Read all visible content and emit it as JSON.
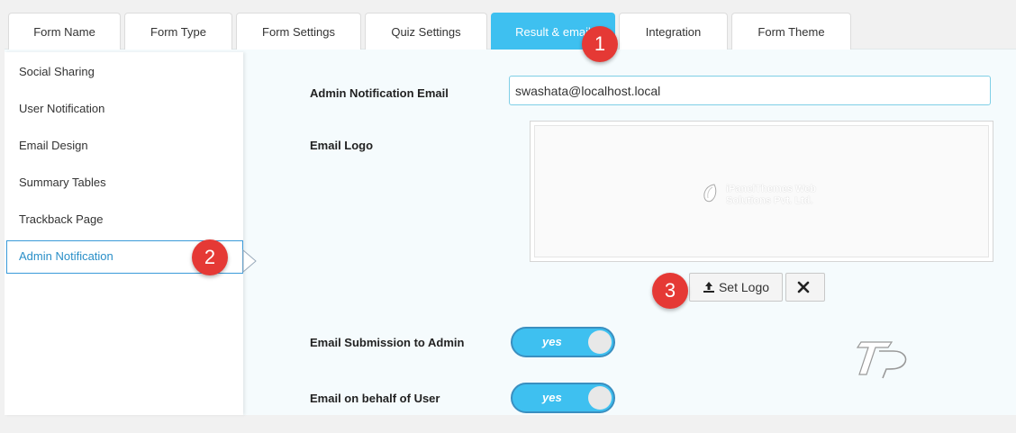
{
  "tabs": [
    {
      "label": "Form Name",
      "active": false
    },
    {
      "label": "Form Type",
      "active": false
    },
    {
      "label": "Form Settings",
      "active": false
    },
    {
      "label": "Quiz Settings",
      "active": false
    },
    {
      "label": "Result & email",
      "active": true
    },
    {
      "label": "Integration",
      "active": false
    },
    {
      "label": "Form Theme",
      "active": false
    }
  ],
  "sidebar": {
    "items": [
      {
        "label": "Social Sharing"
      },
      {
        "label": "User Notification"
      },
      {
        "label": "Email Design"
      },
      {
        "label": "Summary Tables"
      },
      {
        "label": "Trackback Page"
      },
      {
        "label": "Admin Notification",
        "active": true
      }
    ]
  },
  "form": {
    "admin_email_label": "Admin Notification Email",
    "admin_email_value": "swashata@localhost.local",
    "email_logo_label": "Email Logo",
    "logo_company_line1": "iPanelThemes Web",
    "logo_company_line2": "Solutions Pvt. Ltd.",
    "set_logo_label": "Set Logo",
    "submission_to_admin_label": "Email Submission to Admin",
    "submission_to_admin_value": "yes",
    "behalf_of_user_label": "Email on behalf of User",
    "behalf_of_user_value": "yes"
  },
  "badges": {
    "one": "1",
    "two": "2",
    "three": "3"
  },
  "colors": {
    "accent": "#3ec0f0",
    "badge": "#e53935",
    "active_link": "#2a8fc8"
  }
}
